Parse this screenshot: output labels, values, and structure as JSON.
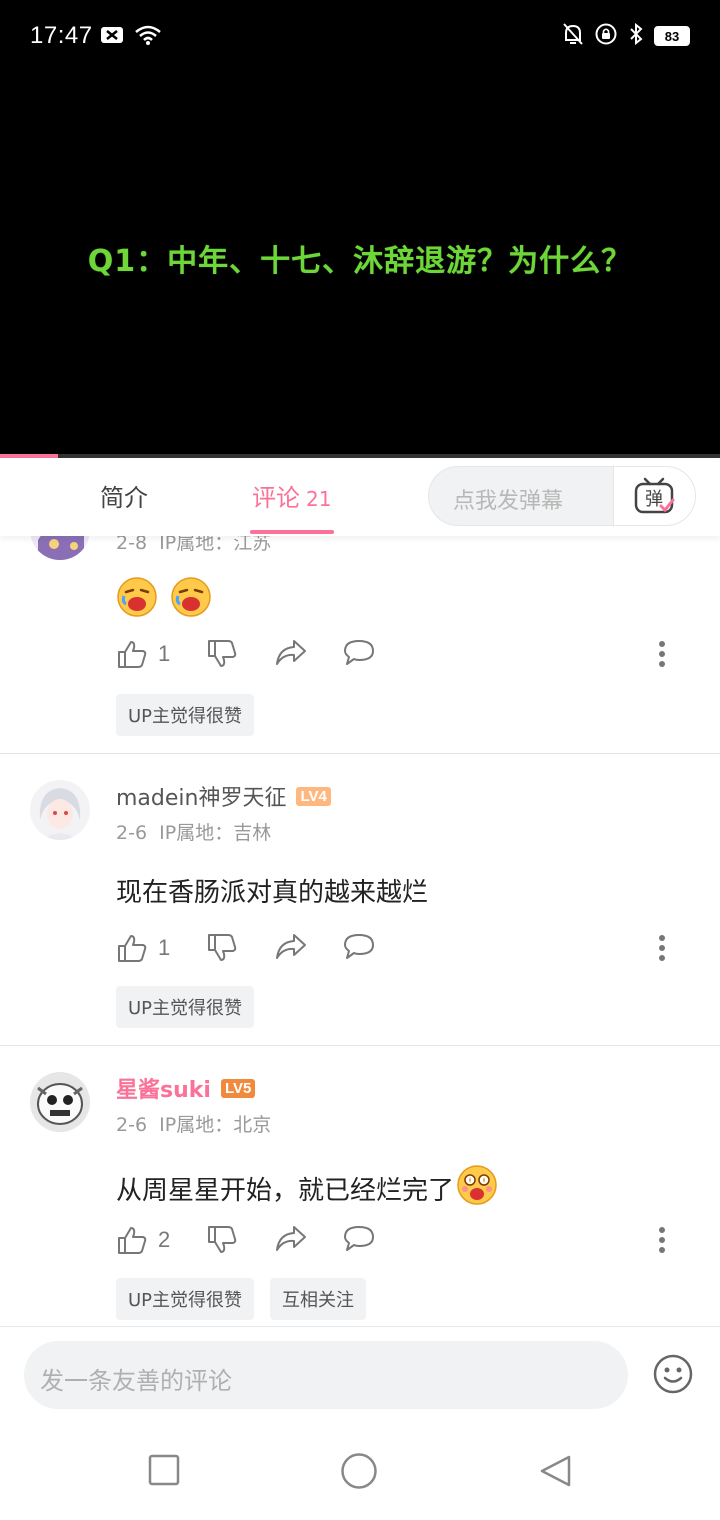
{
  "status_bar": {
    "time": "17:47",
    "battery": "83",
    "left_icons": [
      "x-notification-icon",
      "wifi-icon"
    ],
    "right_icons": [
      "mute-bell-icon",
      "rotation-lock-icon",
      "bluetooth-icon",
      "battery-icon"
    ]
  },
  "video": {
    "subtitle": "Q1：中年、十七、沐辞退游？为什么？",
    "progress_fraction": 0.08
  },
  "tabs": {
    "intro": "简介",
    "comments": "评论",
    "comments_count": "21",
    "danmaku_placeholder": "点我发弹幕",
    "danmaku_icon_text": "弹"
  },
  "comments": [
    {
      "date": "2-8",
      "ip": "IP属地：江苏",
      "emojis": [
        "drooling-emoji",
        "drooling-emoji"
      ],
      "likes": "1",
      "tags": [
        "UP主觉得很赞"
      ]
    },
    {
      "user": "madein神罗天征",
      "level": "LV4",
      "date": "2-6",
      "ip": "IP属地：吉林",
      "text": "现在香肠派对真的越来越烂",
      "likes": "1",
      "tags": [
        "UP主觉得很赞"
      ]
    },
    {
      "user": "星酱suki",
      "level": "LV5",
      "date": "2-6",
      "ip": "IP属地：北京",
      "text": "从周星星开始，就已经烂完了",
      "likes": "2",
      "tags": [
        "UP主觉得很赞",
        "互相关注"
      ]
    }
  ],
  "reply_bar": {
    "placeholder": "发一条友善的评论"
  },
  "colors": {
    "accent": "#fb7299",
    "subtitle": "#6fd63a",
    "lv4": "#feb77e",
    "lv5": "#f08a3c"
  }
}
